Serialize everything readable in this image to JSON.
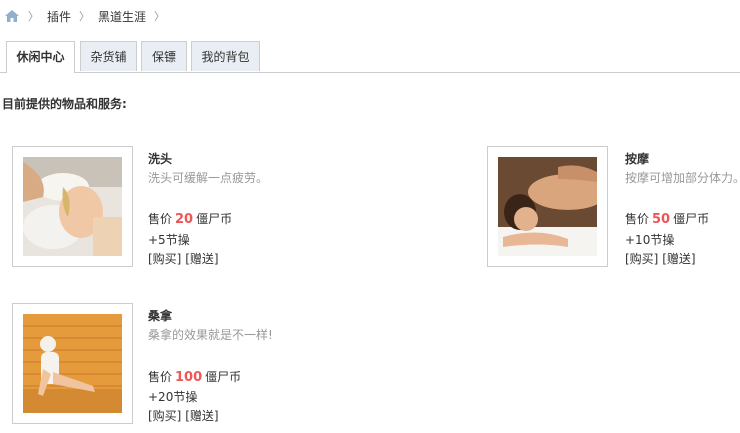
{
  "breadcrumb": {
    "items": [
      "插件",
      "黑道生涯"
    ]
  },
  "tabs": [
    {
      "label": "休闲中心"
    },
    {
      "label": "杂货铺"
    },
    {
      "label": "保镖"
    },
    {
      "label": "我的背包"
    }
  ],
  "intro": "目前提供的物品和服务:",
  "currency": "僵尸币",
  "price_label": "售价",
  "buy_label": "[购买]",
  "gift_label": "[赠送]",
  "items": [
    {
      "name": "洗头",
      "desc": "洗头可缓解一点疲劳。",
      "price": "20",
      "bonus": "+5节操",
      "image": "hair-wash-photo"
    },
    {
      "name": "按摩",
      "desc": "按摩可增加部分体力。",
      "price": "50",
      "bonus": "+10节操",
      "image": "massage-photo"
    },
    {
      "name": "桑拿",
      "desc": "桑拿的效果就是不一样!",
      "price": "100",
      "bonus": "+20节操",
      "image": "sauna-photo"
    }
  ]
}
